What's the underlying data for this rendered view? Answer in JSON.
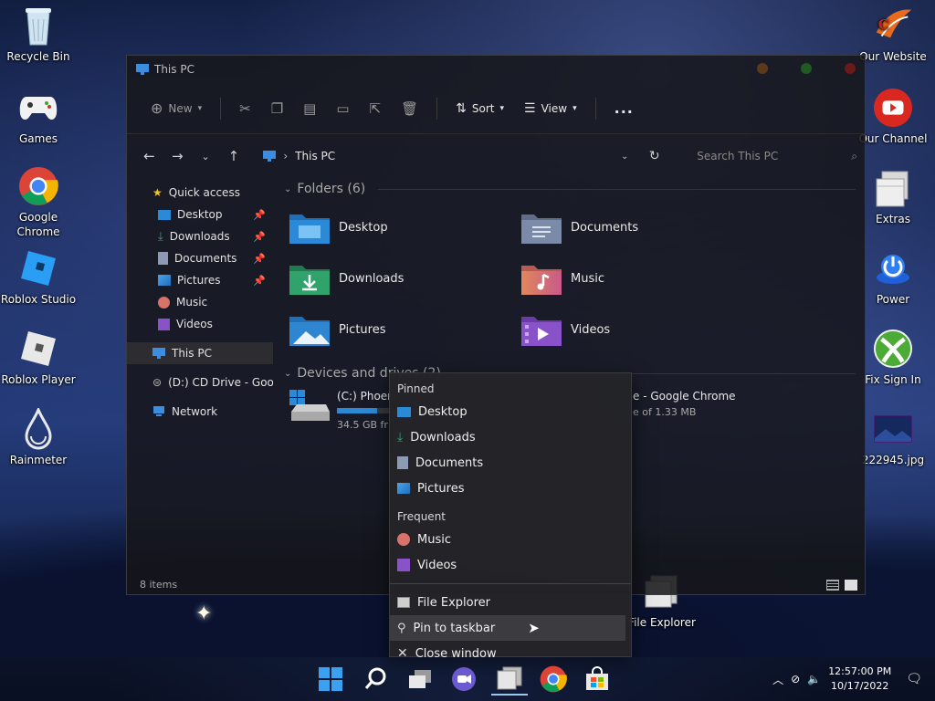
{
  "desktop": {
    "left_icons": [
      {
        "label": "Recycle Bin",
        "icon": "recycle-bin-icon"
      },
      {
        "label": "Games",
        "icon": "game-controller-icon"
      },
      {
        "label": "Google Chrome",
        "icon": "chrome-icon"
      },
      {
        "label": "Roblox Studio",
        "icon": "roblox-studio-icon"
      },
      {
        "label": "Roblox Player",
        "icon": "roblox-player-icon"
      },
      {
        "label": "Rainmeter",
        "icon": "rainmeter-icon"
      }
    ],
    "right_icons": [
      {
        "label": "Our Website",
        "icon": "website-logo-icon"
      },
      {
        "label": "Our Channel",
        "icon": "youtube-icon"
      },
      {
        "label": "Extras",
        "icon": "folder-stack-icon"
      },
      {
        "label": "Power",
        "icon": "power-icon"
      },
      {
        "label": "Fix Sign In",
        "icon": "xbox-icon"
      },
      {
        "label": "222945.jpg",
        "icon": "image-file-icon"
      }
    ],
    "file_explorer_shortcut": "File Explorer"
  },
  "window": {
    "title": "This PC",
    "toolbar": {
      "new": "New",
      "sort": "Sort",
      "view": "View",
      "more": "..."
    },
    "breadcrumb": "This PC",
    "search_placeholder": "Search This PC",
    "status": "8 items"
  },
  "sidebar": {
    "quick_access": "Quick access",
    "pinned": [
      {
        "label": "Desktop",
        "pinned": true
      },
      {
        "label": "Downloads",
        "pinned": true
      },
      {
        "label": "Documents",
        "pinned": true
      },
      {
        "label": "Pictures",
        "pinned": true
      },
      {
        "label": "Music",
        "pinned": false
      },
      {
        "label": "Videos",
        "pinned": false
      }
    ],
    "this_pc": "This PC",
    "cd_drive": "(D:) CD Drive - Goo",
    "network": "Network"
  },
  "content": {
    "folders_header": "Folders (6)",
    "folders": [
      {
        "label": "Desktop",
        "icon": "desktop-folder-icon",
        "color": "#2a8ad8"
      },
      {
        "label": "Documents",
        "icon": "documents-folder-icon",
        "color": "#7b8aa8"
      },
      {
        "label": "Downloads",
        "icon": "downloads-folder-icon",
        "color": "#2fa36b"
      },
      {
        "label": "Music",
        "icon": "music-folder-icon",
        "color": "#d9736a"
      },
      {
        "label": "Pictures",
        "icon": "pictures-folder-icon",
        "color": "#2f86d0"
      },
      {
        "label": "Videos",
        "icon": "videos-folder-icon",
        "color": "#8a52c9"
      }
    ],
    "drives_header": "Devices and drives (2)",
    "drive_c": {
      "label": "(C:) Phoer",
      "free": "34.5 GB fr",
      "used_fraction": 0.4
    },
    "drive_d": {
      "label": "e - Google Chrome",
      "free": "e of 1.33 MB"
    }
  },
  "context_menu": {
    "pinned_header": "Pinned",
    "pinned": [
      "Desktop",
      "Downloads",
      "Documents",
      "Pictures"
    ],
    "frequent_header": "Frequent",
    "frequent": [
      "Music",
      "Videos"
    ],
    "actions": [
      "File Explorer",
      "Pin to taskbar",
      "Close window"
    ]
  },
  "taskbar": {
    "time": "12:57:00 PM",
    "date": "10/17/2022"
  }
}
